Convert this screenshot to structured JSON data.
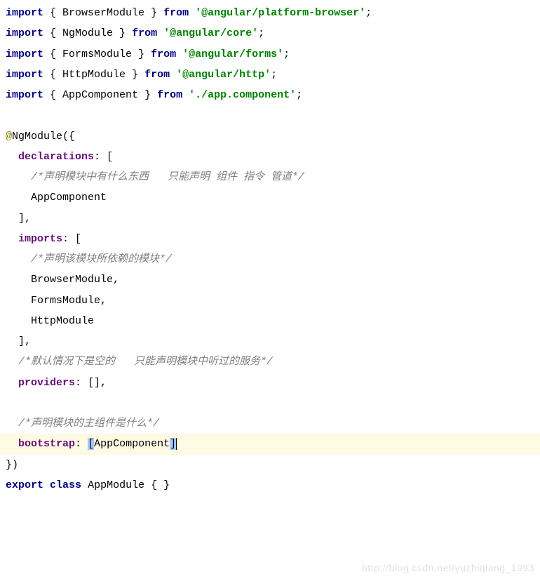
{
  "code": {
    "l1": {
      "kw": "import",
      "open": " { ",
      "name": "BrowserModule",
      "close": " } ",
      "from": "from",
      "sp": " ",
      "mod": "'@angular/platform-browser'",
      "end": ";"
    },
    "l2": {
      "kw": "import",
      "open": " { ",
      "name": "NgModule",
      "close": " } ",
      "from": "from",
      "sp": " ",
      "mod": "'@angular/core'",
      "end": ";"
    },
    "l3": {
      "kw": "import",
      "open": " { ",
      "name": "FormsModule",
      "close": " } ",
      "from": "from",
      "sp": " ",
      "mod": "'@angular/forms'",
      "end": ";"
    },
    "l4": {
      "kw": "import",
      "open": " { ",
      "name": "HttpModule",
      "close": " } ",
      "from": "from",
      "sp": " ",
      "mod": "'@angular/http'",
      "end": ";"
    },
    "l5": {
      "kw": "import",
      "open": " { ",
      "name": "AppComponent",
      "close": " } ",
      "from": "from",
      "sp": " ",
      "mod": "'./app.component'",
      "end": ";"
    },
    "l7": {
      "at": "@",
      "dec": "NgModule",
      "paren": "({"
    },
    "l8": {
      "indent": "  ",
      "prop": "declarations",
      "colon": ": ["
    },
    "l9": {
      "indent": "    ",
      "comment": "/*声明模块中有什么东西   只能声明 组件 指令 管道*/"
    },
    "l10": {
      "indent": "    ",
      "name": "AppComponent"
    },
    "l11": {
      "indent": "  ",
      "close": "],"
    },
    "l12": {
      "indent": "  ",
      "prop": "imports",
      "colon": ": ["
    },
    "l13": {
      "indent": "    ",
      "comment": "/*声明该模块所依赖的模块*/"
    },
    "l14": {
      "indent": "    ",
      "name": "BrowserModule,",
      "t": "BrowserModule",
      "comma": ","
    },
    "l15": {
      "indent": "    ",
      "t": "FormsModule",
      "comma": ","
    },
    "l16": {
      "indent": "    ",
      "t": "HttpModule"
    },
    "l17": {
      "indent": "  ",
      "close": "],"
    },
    "l18": {
      "indent": "  ",
      "comment": "/*默认情况下是空的   只能声明模块中听过的服务*/"
    },
    "l19": {
      "indent": "  ",
      "prop": "providers",
      "colon": ": [],"
    },
    "l21": {
      "indent": "  ",
      "comment": "/*声明模块的主组件是什么*/"
    },
    "l22": {
      "indent": "  ",
      "prop": "bootstrap",
      "colon": ": ",
      "selOpen": "[",
      "comp": "AppComponent",
      "selClose": "]"
    },
    "l23": {
      "close": "})"
    },
    "l24": {
      "kw1": "export",
      "sp": " ",
      "kw2": "class",
      "sp2": " ",
      "name": "AppModule",
      "body": " { }"
    }
  },
  "watermark": "http://blog.csdn.net/yuzhiqiang_1993"
}
